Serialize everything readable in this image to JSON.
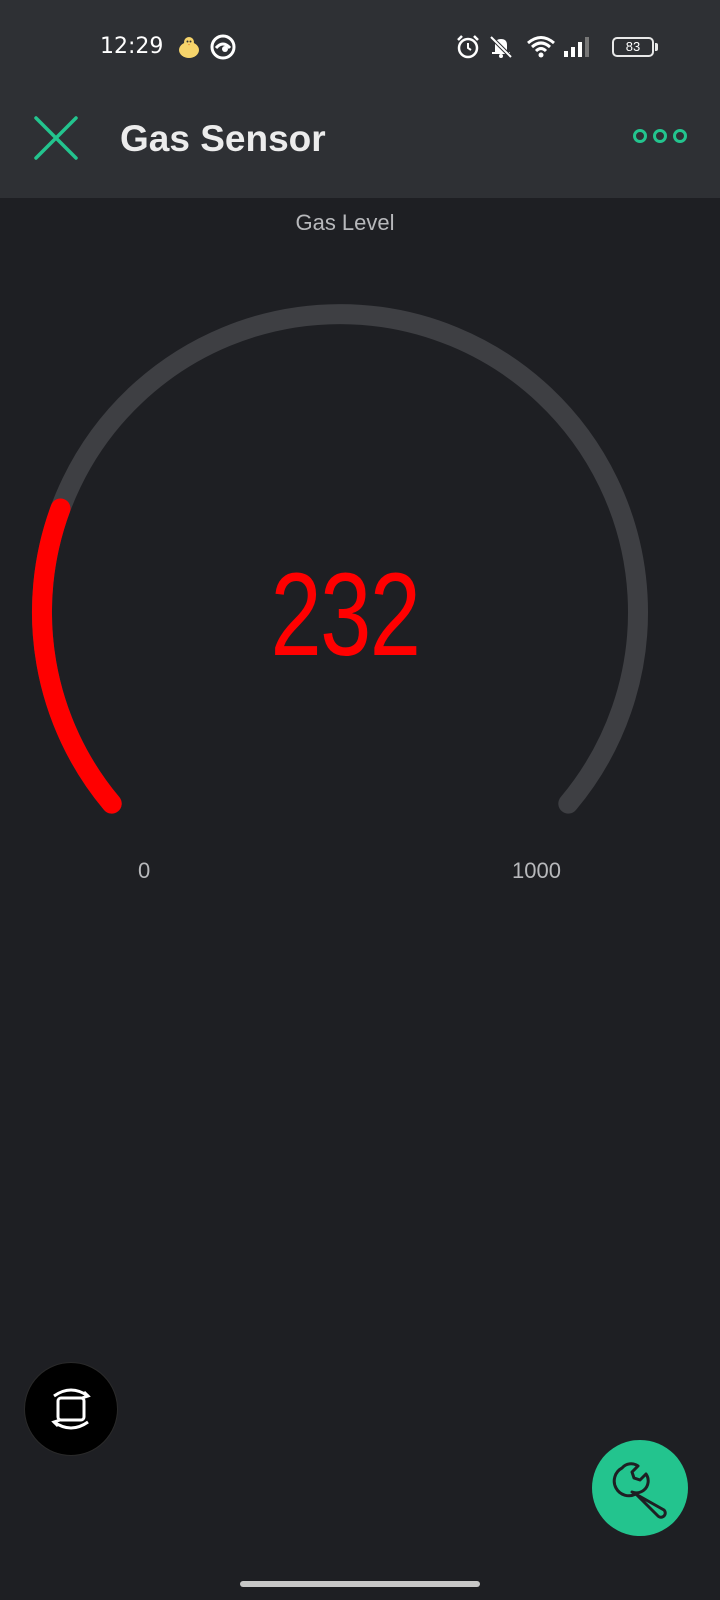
{
  "status_bar": {
    "time": "12:29",
    "battery": "83",
    "icons": [
      "chick-emoji-icon",
      "edge-browser-icon",
      "alarm-icon",
      "mute-icon",
      "wifi-icon",
      "signal-icon",
      "battery-icon"
    ]
  },
  "app_bar": {
    "title": "Gas Sensor",
    "close_icon": "close-icon",
    "more_icon": "more-dots-icon"
  },
  "gauge": {
    "label": "Gas Level",
    "value": "232",
    "min": "0",
    "max": "1000",
    "fraction": 0.232
  },
  "colors": {
    "accent": "#23c48e",
    "gauge_fill": "#ff0000",
    "gauge_track": "#3e3f43",
    "background": "#1e1f23",
    "bar": "#2e3034"
  },
  "floating": {
    "rotate_icon": "screen-rotate-icon",
    "settings_icon": "wrench-icon"
  }
}
